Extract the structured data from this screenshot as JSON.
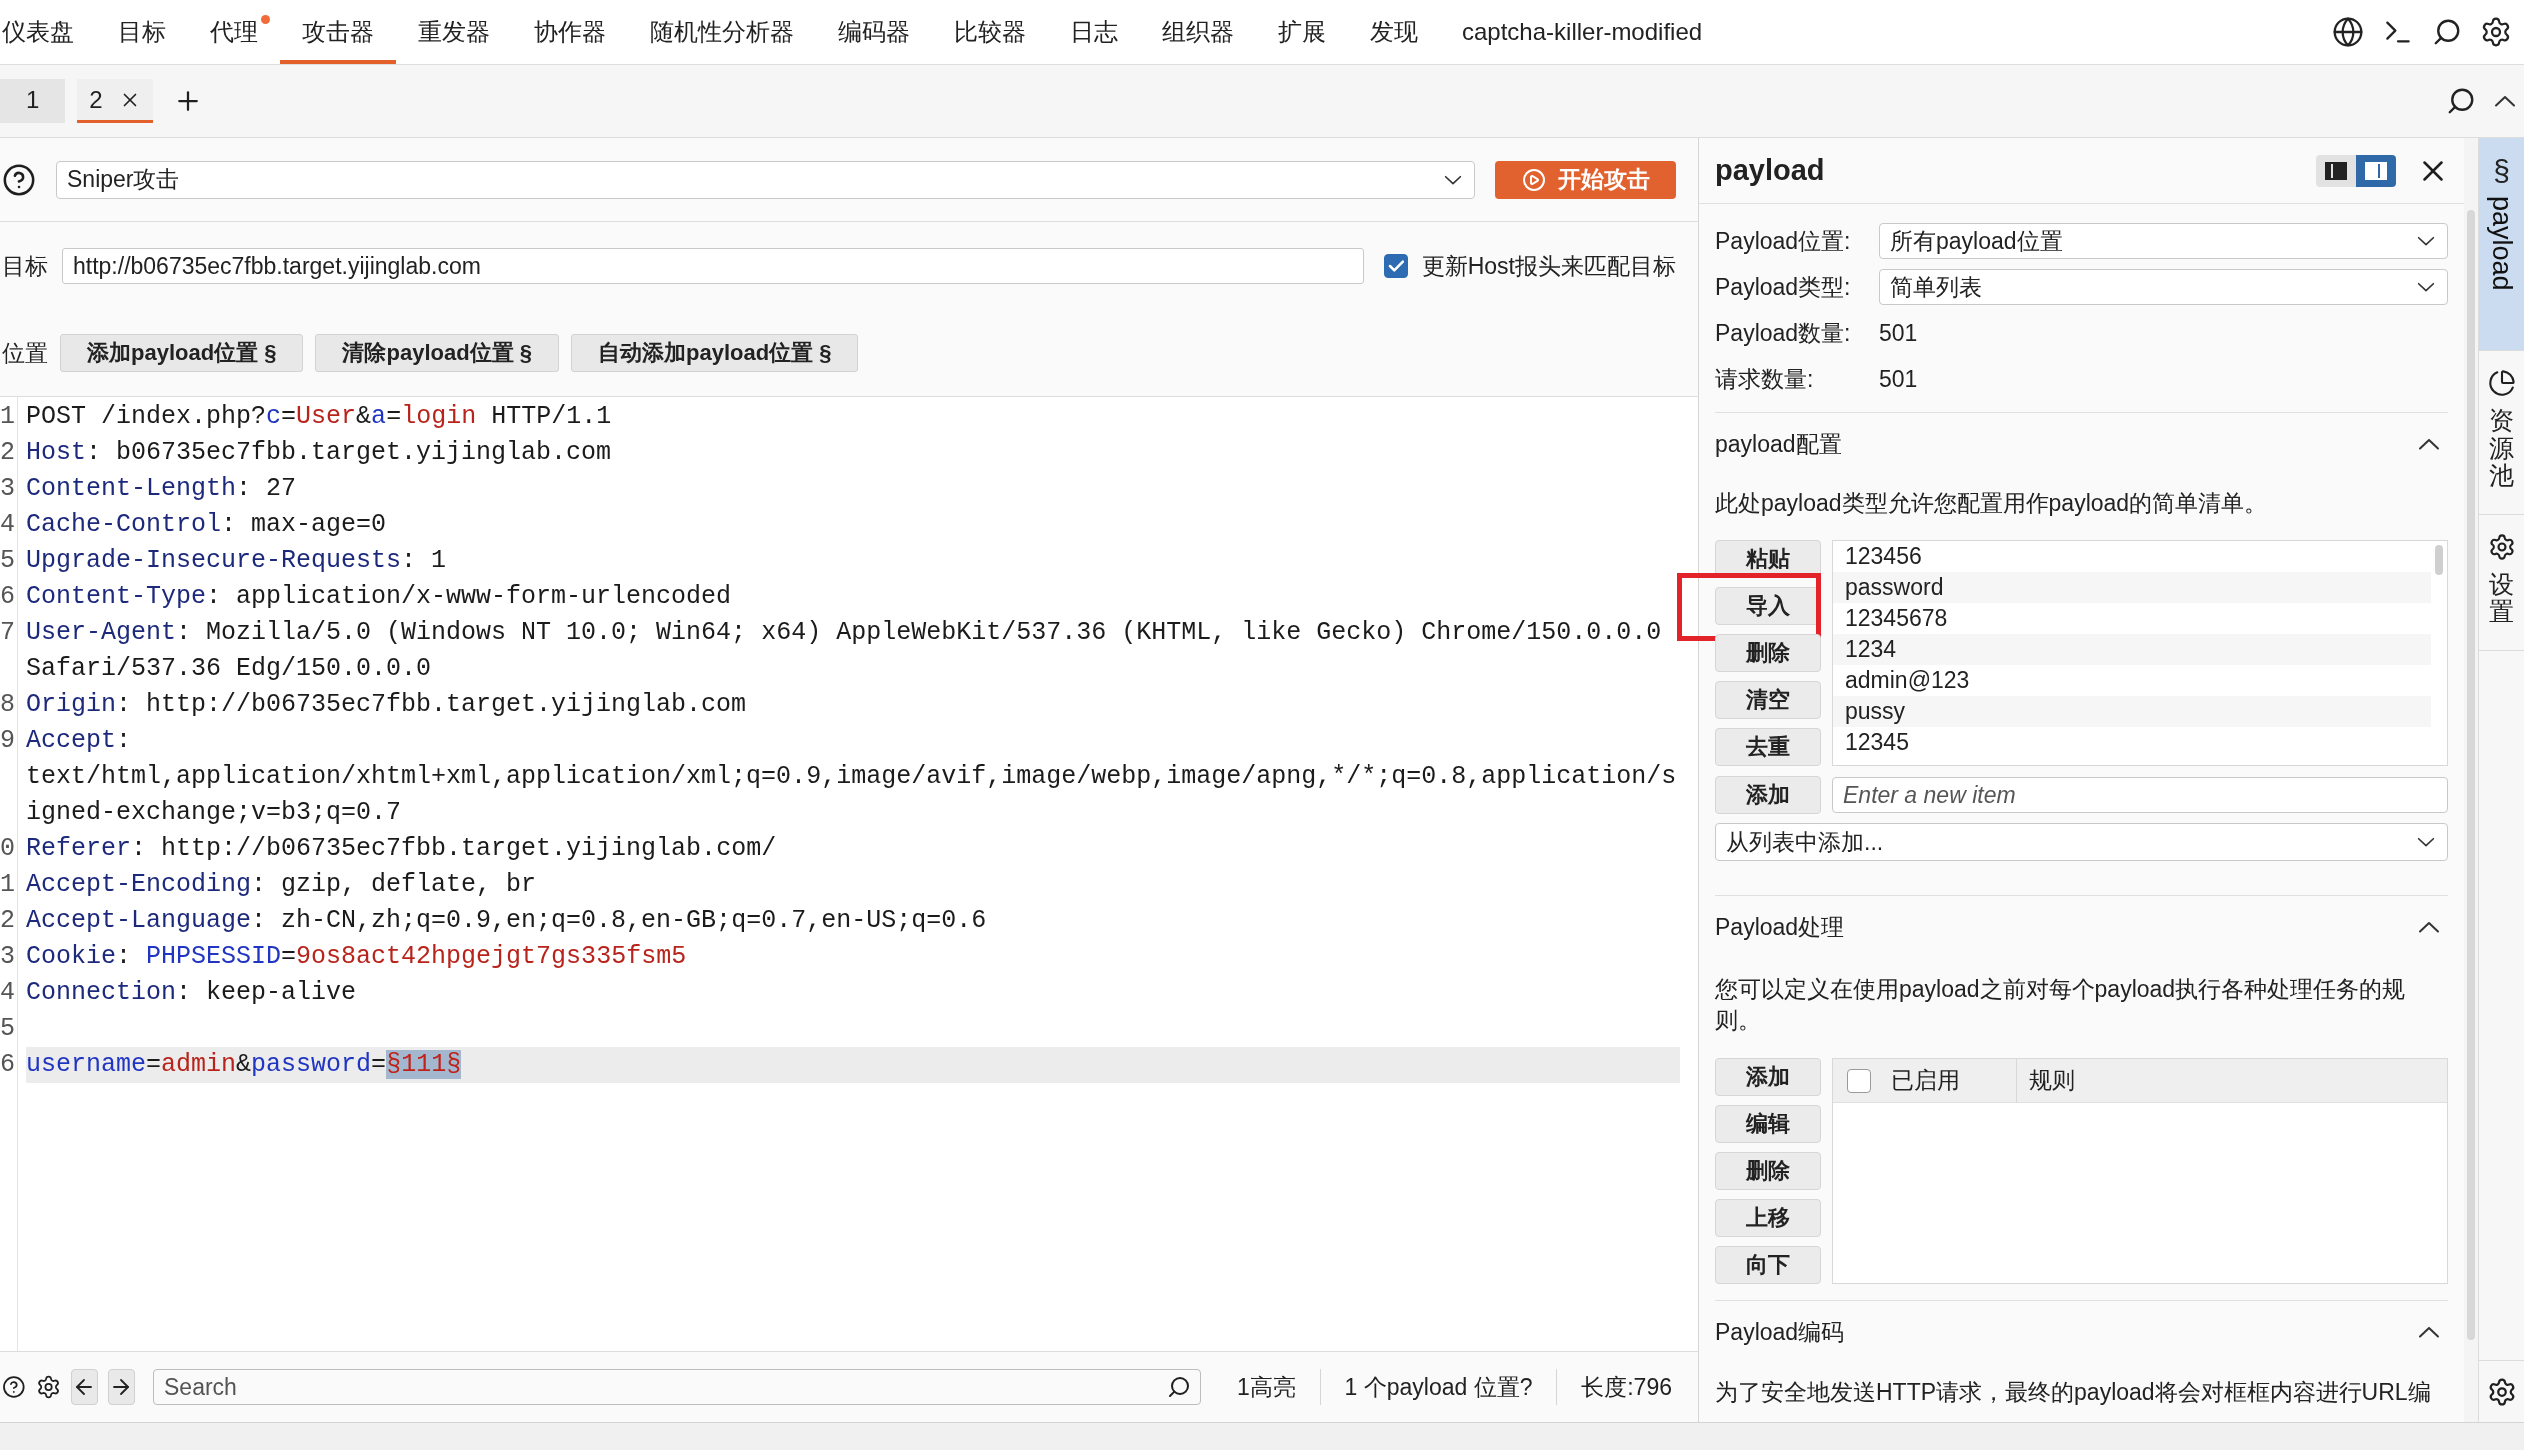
{
  "nav": {
    "tabs": [
      {
        "label": "仪表盘",
        "selected": false,
        "notification": false
      },
      {
        "label": "目标",
        "selected": false,
        "notification": false
      },
      {
        "label": "代理",
        "selected": false,
        "notification": true
      },
      {
        "label": "攻击器",
        "selected": true,
        "notification": false
      },
      {
        "label": "重发器",
        "selected": false,
        "notification": false
      },
      {
        "label": "协作器",
        "selected": false,
        "notification": false
      },
      {
        "label": "随机性分析器",
        "selected": false,
        "notification": false
      },
      {
        "label": "编码器",
        "selected": false,
        "notification": false
      },
      {
        "label": "比较器",
        "selected": false,
        "notification": false
      },
      {
        "label": "日志",
        "selected": false,
        "notification": false
      },
      {
        "label": "组织器",
        "selected": false,
        "notification": false
      },
      {
        "label": "扩展",
        "selected": false,
        "notification": false
      },
      {
        "label": "发现",
        "selected": false,
        "notification": false
      },
      {
        "label": "captcha-killer-modified",
        "selected": false,
        "notification": false
      }
    ]
  },
  "attack_tabs": [
    {
      "label": "1",
      "selected": false
    },
    {
      "label": "2",
      "selected": true
    }
  ],
  "attack_bar": {
    "attack_type": "Sniper攻击",
    "start_button": "开始攻击"
  },
  "target": {
    "label": "目标",
    "value": "http://b06735ec7fbb.target.yijinglab.com",
    "update_host": {
      "label": "更新Host报头来匹配目标",
      "checked": true
    }
  },
  "positions": {
    "label": "位置",
    "buttons": [
      "添加payload位置 §",
      "清除payload位置 §",
      "自动添加payload位置 §"
    ]
  },
  "editor": {
    "lines": [
      {
        "number": "1",
        "highlighted": false,
        "segments": [
          {
            "kind": "plain",
            "text": "POST /index.php?"
          },
          {
            "kind": "param",
            "text": "c"
          },
          {
            "kind": "plain",
            "text": "="
          },
          {
            "kind": "value",
            "text": "User"
          },
          {
            "kind": "plain",
            "text": "&"
          },
          {
            "kind": "param",
            "text": "a"
          },
          {
            "kind": "plain",
            "text": "="
          },
          {
            "kind": "value",
            "text": "login"
          },
          {
            "kind": "plain",
            "text": " HTTP/1.1"
          }
        ]
      },
      {
        "number": "2",
        "highlighted": false,
        "segments": [
          {
            "kind": "header",
            "text": "Host"
          },
          {
            "kind": "plain",
            "text": ": b06735ec7fbb.target.yijinglab.com"
          }
        ]
      },
      {
        "number": "3",
        "highlighted": false,
        "segments": [
          {
            "kind": "header",
            "text": "Content-Length"
          },
          {
            "kind": "plain",
            "text": ": 27"
          }
        ]
      },
      {
        "number": "4",
        "highlighted": false,
        "segments": [
          {
            "kind": "header",
            "text": "Cache-Control"
          },
          {
            "kind": "plain",
            "text": ": max-age=0"
          }
        ]
      },
      {
        "number": "5",
        "highlighted": false,
        "segments": [
          {
            "kind": "header",
            "text": "Upgrade-Insecure-Requests"
          },
          {
            "kind": "plain",
            "text": ": 1"
          }
        ]
      },
      {
        "number": "6",
        "highlighted": false,
        "segments": [
          {
            "kind": "header",
            "text": "Content-Type"
          },
          {
            "kind": "plain",
            "text": ": application/x-www-form-urlencoded"
          }
        ]
      },
      {
        "number": "7",
        "highlighted": false,
        "segments": [
          {
            "kind": "header",
            "text": "User-Agent"
          },
          {
            "kind": "plain",
            "text": ": Mozilla/5.0 (Windows NT 10.0; Win64; x64) AppleWebKit/537.36 (KHTML, like Gecko) Chrome/150.0.0.0 Safari/537.36 Edg/150.0.0.0"
          }
        ]
      },
      {
        "number": "8",
        "highlighted": false,
        "segments": [
          {
            "kind": "header",
            "text": "Origin"
          },
          {
            "kind": "plain",
            "text": ": http://b06735ec7fbb.target.yijinglab.com"
          }
        ]
      },
      {
        "number": "9",
        "highlighted": false,
        "segments": [
          {
            "kind": "header",
            "text": "Accept"
          },
          {
            "kind": "plain",
            "text": ": text/html,application/xhtml+xml,application/xml;q=0.9,image/avif,image/webp,image/apng,*/*;q=0.8,application/signed-exchange;v=b3;q=0.7"
          }
        ]
      },
      {
        "number": "0",
        "highlighted": false,
        "segments": [
          {
            "kind": "header",
            "text": "Referer"
          },
          {
            "kind": "plain",
            "text": ": http://b06735ec7fbb.target.yijinglab.com/"
          }
        ]
      },
      {
        "number": "1",
        "highlighted": false,
        "segments": [
          {
            "kind": "header",
            "text": "Accept-Encoding"
          },
          {
            "kind": "plain",
            "text": ": gzip, deflate, br"
          }
        ]
      },
      {
        "number": "2",
        "highlighted": false,
        "segments": [
          {
            "kind": "header",
            "text": "Accept-Language"
          },
          {
            "kind": "plain",
            "text": ": zh-CN,zh;q=0.9,en;q=0.8,en-GB;q=0.7,en-US;q=0.6"
          }
        ]
      },
      {
        "number": "3",
        "highlighted": false,
        "segments": [
          {
            "kind": "header",
            "text": "Cookie"
          },
          {
            "kind": "plain",
            "text": ": "
          },
          {
            "kind": "param",
            "text": "PHPSESSID"
          },
          {
            "kind": "plain",
            "text": "="
          },
          {
            "kind": "value",
            "text": "9os8act42hpgejgt7gs335fsm5"
          }
        ]
      },
      {
        "number": "4",
        "highlighted": false,
        "segments": [
          {
            "kind": "header",
            "text": "Connection"
          },
          {
            "kind": "plain",
            "text": ": keep-alive"
          }
        ]
      },
      {
        "number": "5",
        "highlighted": false
      },
      {
        "number": "6",
        "highlighted": true,
        "segments": [
          {
            "kind": "param",
            "text": "username"
          },
          {
            "kind": "plain",
            "text": "="
          },
          {
            "kind": "value",
            "text": "admin"
          },
          {
            "kind": "plain",
            "text": "&"
          },
          {
            "kind": "param",
            "text": "password"
          },
          {
            "kind": "plain",
            "text": "="
          },
          {
            "kind": "marker",
            "text": "§111§"
          }
        ]
      }
    ]
  },
  "search_bar": {
    "placeholder": "Search",
    "highlights": "1高亮",
    "payload_positions": "1 个payload 位置?",
    "length": "长度:796"
  },
  "payload_panel": {
    "title": "payload",
    "view_modes": [
      {
        "selected": false
      },
      {
        "selected": true
      }
    ],
    "fields": [
      {
        "kind": "select",
        "label": "Payload位置:",
        "value": "所有payload位置"
      },
      {
        "kind": "select",
        "label": "Payload类型:",
        "value": "简单列表"
      },
      {
        "kind": "text",
        "label": "Payload数量:",
        "value": "501"
      },
      {
        "kind": "text",
        "label": "请求数量:",
        "value": "501"
      }
    ],
    "config": {
      "title": "payload配置",
      "expanded": true,
      "description": "此处payload类型允许您配置用作payload的简单清单。",
      "buttons": [
        {
          "label": "粘贴",
          "annotated": false
        },
        {
          "label": "导入",
          "annotated": true
        },
        {
          "label": "删除",
          "annotated": false
        },
        {
          "label": "清空",
          "annotated": false
        },
        {
          "label": "去重",
          "annotated": false
        }
      ],
      "items": [
        "123456",
        "password",
        "12345678",
        "1234",
        "admin@123",
        "pussy",
        "12345"
      ],
      "add_button": "添加",
      "new_item_placeholder": "Enter a new item",
      "add_from_list": "从列表中添加..."
    },
    "processing": {
      "title": "Payload处理",
      "expanded": true,
      "description": "您可以定义在使用payload之前对每个payload执行各种处理任务的规则。",
      "buttons": [
        "添加",
        "编辑",
        "删除",
        "上移",
        "向下"
      ],
      "table": {
        "header_checked": false,
        "columns": [
          "已启用",
          "规则"
        ]
      }
    },
    "encoding": {
      "title": "Payload编码",
      "expanded": true,
      "description": "为了安全地发送HTTP请求，最终的payload将会对框框内容进行URL编"
    }
  },
  "side_tabs": [
    {
      "kind": "rotated",
      "glyph": "§",
      "label": "payload",
      "selected": true
    },
    {
      "kind": "stacked",
      "label": "资源池",
      "selected": false
    },
    {
      "kind": "stacked",
      "label": "设置",
      "selected": false
    }
  ]
}
